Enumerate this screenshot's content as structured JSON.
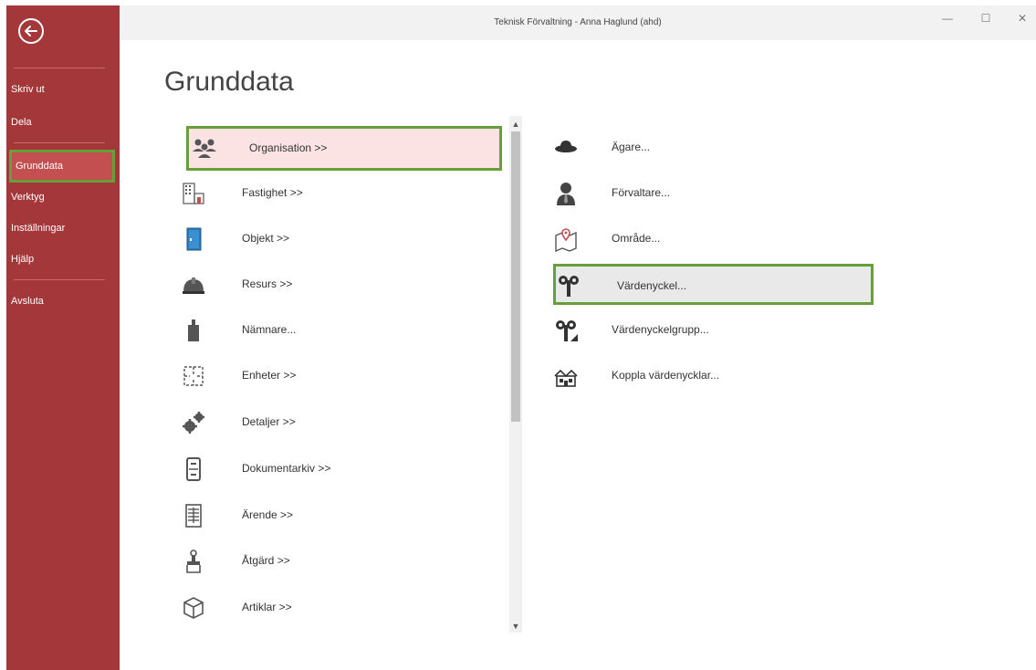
{
  "window": {
    "title": "Teknisk Förvaltning - Anna Haglund (ahd)"
  },
  "sidebar": {
    "items": [
      {
        "label": "Skriv ut"
      },
      {
        "label": "Dela"
      },
      {
        "label": "Grunddata",
        "active": true
      },
      {
        "label": "Verktyg"
      },
      {
        "label": "Inställningar"
      },
      {
        "label": "Hjälp"
      },
      {
        "label": "Avsluta"
      }
    ]
  },
  "page": {
    "heading": "Grunddata"
  },
  "left_list": [
    {
      "label": "Organisation >>",
      "icon": "group-icon",
      "selected": true
    },
    {
      "label": "Fastighet >>",
      "icon": "building-icon"
    },
    {
      "label": "Objekt >>",
      "icon": "door-icon"
    },
    {
      "label": "Resurs >>",
      "icon": "hardhat-icon"
    },
    {
      "label": "Nämnare...",
      "icon": "weight-icon"
    },
    {
      "label": "Enheter >>",
      "icon": "floorplan-icon"
    },
    {
      "label": "Detaljer >>",
      "icon": "gears-icon"
    },
    {
      "label": "Dokumentarkiv >>",
      "icon": "cabinet-icon"
    },
    {
      "label": "Ärende >>",
      "icon": "form-icon"
    },
    {
      "label": "Åtgärd >>",
      "icon": "brush-icon"
    },
    {
      "label": "Artiklar >>",
      "icon": "cube-icon"
    }
  ],
  "right_list": [
    {
      "label": "Ägare...",
      "icon": "hat-icon"
    },
    {
      "label": "Förvaltare...",
      "icon": "person-icon"
    },
    {
      "label": "Område...",
      "icon": "map-pin-icon"
    },
    {
      "label": "Värdenyckel...",
      "icon": "key-icon",
      "selected": true
    },
    {
      "label": "Värdenyckelgrupp...",
      "icon": "key-group-icon"
    },
    {
      "label": "Koppla värdenycklar...",
      "icon": "houses-icon"
    }
  ],
  "colors": {
    "sidebar": "#a4373a",
    "highlight_border": "#67a03a",
    "selected_pink": "#fbe2e3"
  }
}
